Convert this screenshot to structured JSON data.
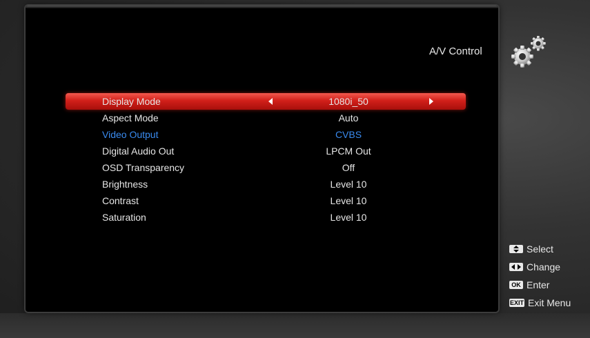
{
  "header": {
    "title": "A/V Control"
  },
  "menu": {
    "items": [
      {
        "label": "Display Mode",
        "value": "1080i_50"
      },
      {
        "label": "Aspect Mode",
        "value": "Auto"
      },
      {
        "label": "Video Output",
        "value": "CVBS"
      },
      {
        "label": "Digital Audio Out",
        "value": "LPCM Out"
      },
      {
        "label": "OSD Transparency",
        "value": "Off"
      },
      {
        "label": "Brightness",
        "value": "Level 10"
      },
      {
        "label": "Contrast",
        "value": "Level 10"
      },
      {
        "label": "Saturation",
        "value": "Level 10"
      }
    ],
    "selected_index": 0,
    "active_index": 2
  },
  "legend": {
    "select": {
      "key": "up-down",
      "label": "Select"
    },
    "change": {
      "key": "left-right",
      "label": "Change"
    },
    "enter": {
      "key": "OK",
      "label": "Enter"
    },
    "exit": {
      "key": "EXIT",
      "label": "Exit Menu"
    }
  },
  "colors": {
    "selected_row": "#d2201a",
    "active_text": "#3a8bf0",
    "background": "#2a2a2a",
    "panel": "#000000"
  }
}
